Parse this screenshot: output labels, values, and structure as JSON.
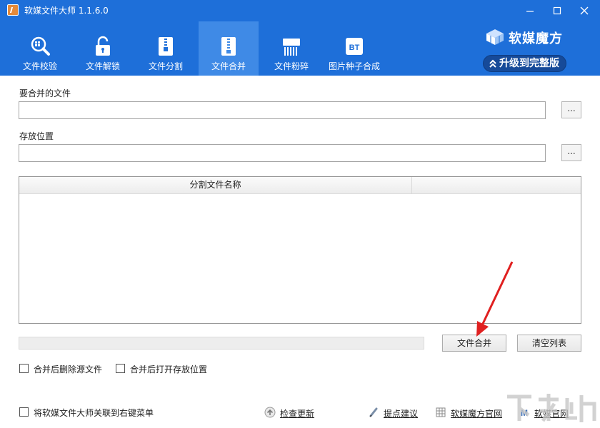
{
  "window": {
    "title": "软媒文件大师 1.1.6.0",
    "controls": {
      "minimize": "—",
      "maximize": "□",
      "close": "✕"
    }
  },
  "tabs": [
    {
      "label": "文件校验",
      "icon": "magnifier-icon"
    },
    {
      "label": "文件解锁",
      "icon": "lock-icon"
    },
    {
      "label": "文件分割",
      "icon": "zip-split-icon"
    },
    {
      "label": "文件合并",
      "icon": "zip-merge-icon",
      "active": true
    },
    {
      "label": "文件粉碎",
      "icon": "shredder-icon"
    },
    {
      "label": "图片种子合成",
      "icon": "bt-icon",
      "icon_text": "BT"
    }
  ],
  "brand": {
    "name": "软媒魔方",
    "upgrade_label": "升级到完整版"
  },
  "form": {
    "source_label": "要合并的文件",
    "source_value": "",
    "dest_label": "存放位置",
    "dest_value": "",
    "browse_label": "..."
  },
  "list": {
    "column_name": "分割文件名称",
    "rows": []
  },
  "actions": {
    "merge_label": "文件合并",
    "clear_label": "清空列表"
  },
  "options": {
    "delete_after_merge": {
      "label": "合并后删除源文件",
      "checked": false
    },
    "open_after_merge": {
      "label": "合并后打开存放位置",
      "checked": false
    },
    "context_menu": {
      "label": "将软媒文件大师关联到右键菜单",
      "checked": false
    }
  },
  "footer": {
    "check_update": "检查更新",
    "feedback": "提点建议",
    "mofang_site": "软媒魔方官网",
    "ruanmei_site": "软媒官网"
  },
  "colors": {
    "header_bg": "#1e6fd9",
    "active_tab_bg": "#3f8ae6",
    "upgrade_bg": "#164a99",
    "annotation_arrow": "#e02020"
  }
}
